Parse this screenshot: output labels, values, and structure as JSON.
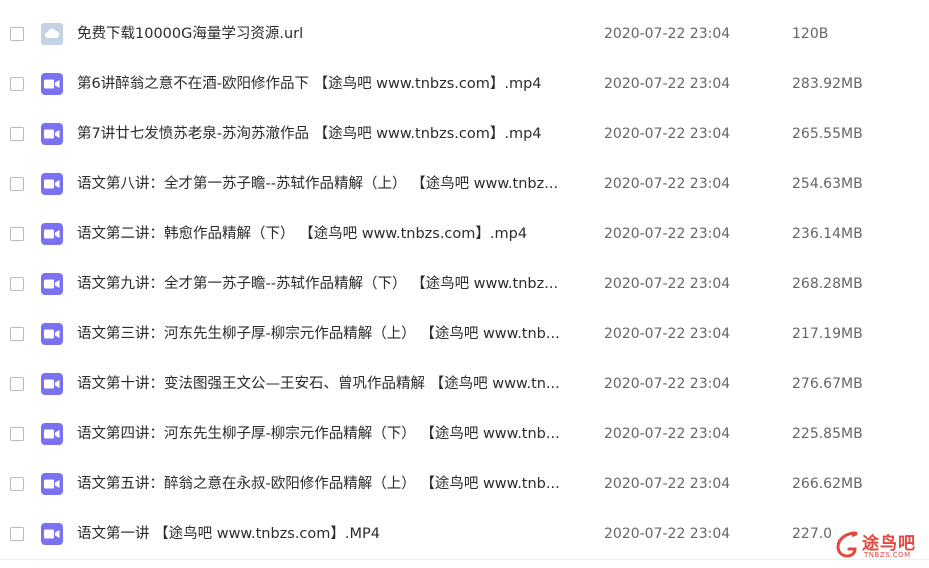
{
  "files": [
    {
      "icon": "url-file-icon",
      "name": "免费下载10000G海量学习资源.url",
      "date": "2020-07-22 23:04",
      "size": "120B"
    },
    {
      "icon": "video-file-icon",
      "name": "第6讲醉翁之意不在酒-欧阳修作品下 【途鸟吧 www.tnbzs.com】.mp4",
      "date": "2020-07-22 23:04",
      "size": "283.92MB"
    },
    {
      "icon": "video-file-icon",
      "name": "第7讲廿七发愤苏老泉-苏洵苏澈作品 【途鸟吧 www.tnbzs.com】.mp4",
      "date": "2020-07-22 23:04",
      "size": "265.55MB"
    },
    {
      "icon": "video-file-icon",
      "name": "语文第八讲：全才第一苏子瞻--苏轼作品精解（上） 【途鸟吧 www.tnbz...",
      "date": "2020-07-22 23:04",
      "size": "254.63MB"
    },
    {
      "icon": "video-file-icon",
      "name": "语文第二讲：韩愈作品精解（下） 【途鸟吧 www.tnbzs.com】.mp4",
      "date": "2020-07-22 23:04",
      "size": "236.14MB"
    },
    {
      "icon": "video-file-icon",
      "name": "语文第九讲：全才第一苏子瞻--苏轼作品精解（下） 【途鸟吧 www.tnbz...",
      "date": "2020-07-22 23:04",
      "size": "268.28MB"
    },
    {
      "icon": "video-file-icon",
      "name": "语文第三讲：河东先生柳子厚-柳宗元作品精解（上） 【途鸟吧 www.tnb...",
      "date": "2020-07-22 23:04",
      "size": "217.19MB"
    },
    {
      "icon": "video-file-icon",
      "name": "语文第十讲：变法图强王文公—王安石、曾巩作品精解 【途鸟吧 www.tn...",
      "date": "2020-07-22 23:04",
      "size": "276.67MB"
    },
    {
      "icon": "video-file-icon",
      "name": "语文第四讲：河东先生柳子厚-柳宗元作品精解（下） 【途鸟吧 www.tnb...",
      "date": "2020-07-22 23:04",
      "size": "225.85MB"
    },
    {
      "icon": "video-file-icon",
      "name": "语文第五讲：醉翁之意在永叔-欧阳修作品精解（上） 【途鸟吧 www.tnb...",
      "date": "2020-07-22 23:04",
      "size": "266.62MB"
    },
    {
      "icon": "video-file-icon",
      "name": "语文第一讲 【途鸟吧 www.tnbzs.com】.MP4",
      "date": "2020-07-22 23:04",
      "size": "227.0"
    }
  ],
  "watermark": {
    "text": "途鸟吧",
    "sub": "TNBZS.COM"
  },
  "colors": {
    "video_icon": "#7a72f0",
    "url_icon": "#c4d3e3",
    "watermark": "#e2483d"
  }
}
